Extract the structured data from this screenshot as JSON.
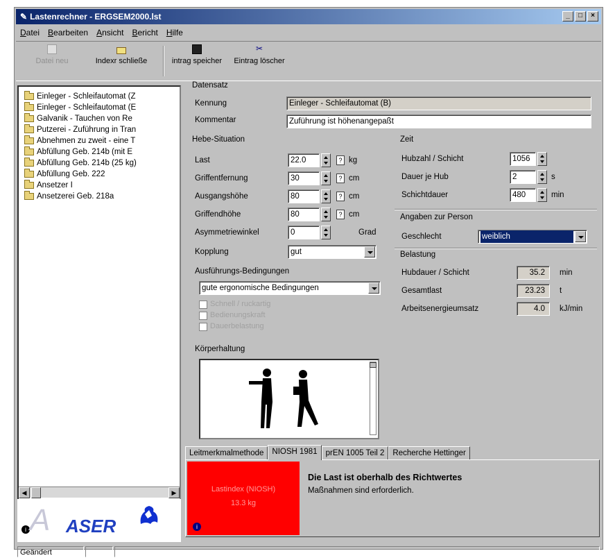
{
  "window": {
    "title": "Lastenrechner - ERGSEM2000.lst",
    "controls": [
      "_",
      "□",
      "×"
    ]
  },
  "menu": [
    "Datei",
    "Bearbeiten",
    "Ansicht",
    "Bericht",
    "Hilfe"
  ],
  "toolbar": {
    "new_label": "Datei neu",
    "close_label": "Indexr schließe",
    "save_label": "intrag speicher",
    "delete_label": "Eintrag löscher"
  },
  "tree": {
    "items": [
      "Einleger - Schleifautomat (Z",
      "Einleger - Schleifautomat (E",
      "Galvanik - Tauchen von Re",
      "Putzerei - Zuführung in Tran",
      "Abnehmen zu zweit - eine T",
      "Abfüllung Geb. 214b (mit E",
      "Abfüllung Geb. 214b (25 kg)",
      "Abfüllung Geb. 222",
      "Ansetzer I",
      "Ansetzerei Geb. 218a"
    ]
  },
  "logo": {
    "text": "ASER",
    "sub": "ASER"
  },
  "datensatz": {
    "title": "Datensatz",
    "kennung_label": "Kennung",
    "kennung_value": "Einleger - Schleifautomat (B)",
    "kommentar_label": "Kommentar",
    "kommentar_value": "Zuführung ist höhenangepaßt"
  },
  "hebe": {
    "title": "Hebe-Situation",
    "rows": [
      {
        "label": "Last",
        "value": "22.0",
        "unit": "kg"
      },
      {
        "label": "Griffentfernung",
        "value": "30",
        "unit": "cm"
      },
      {
        "label": "Ausgangshöhe",
        "value": "80",
        "unit": "cm"
      },
      {
        "label": "Griffendhöhe",
        "value": "80",
        "unit": "cm"
      },
      {
        "label": "Asymmetriewinkel",
        "value": "0",
        "unit": "Grad"
      }
    ],
    "kopplung_label": "Kopplung",
    "kopplung_value": "gut"
  },
  "ausfuehrung": {
    "title": "Ausführungs-Bedingungen",
    "value": "gute ergonomische Bedingungen",
    "checkboxes": [
      "Schnell / ruckartig",
      "Bedienungskraft",
      "Dauerbelastung"
    ]
  },
  "koerper": {
    "title": "Körperhaltung"
  },
  "zeit": {
    "title": "Zeit",
    "rows": [
      {
        "label": "Hubzahl / Schicht",
        "value": "1056",
        "unit": ""
      },
      {
        "label": "Dauer je Hub",
        "value": "2",
        "unit": "s"
      },
      {
        "label": "Schichtdauer",
        "value": "480",
        "unit": "min"
      }
    ]
  },
  "person": {
    "title": "Angaben zur Person",
    "geschlecht_label": "Geschlecht",
    "geschlecht_value": "weiblich"
  },
  "belastung": {
    "title": "Belastung",
    "rows": [
      {
        "label": "Hubdauer / Schicht",
        "value": "35.2",
        "unit": "min"
      },
      {
        "label": "Gesamtlast",
        "value": "23.23",
        "unit": "t"
      },
      {
        "label": "Arbeitsenergieumsatz",
        "value": "4.0",
        "unit": "kJ/min"
      }
    ]
  },
  "tabs": [
    "Leitmerkmalmethode",
    "NIOSH 1981",
    "prEN 1005 Teil 2",
    "Recherche Hettinger"
  ],
  "result": {
    "box_line1": "Lastindex (NIOSH)",
    "box_line2": "13.3 kg",
    "heading": "Die Last ist oberhalb des Richtwertes",
    "text": "Maßnahmen sind erforderlich."
  },
  "status": {
    "text": "Geändert"
  },
  "colors": {
    "title_start": "#0a246a",
    "title_end": "#a6caf0",
    "alert": "#ff0000",
    "selection": "#0a246a"
  }
}
